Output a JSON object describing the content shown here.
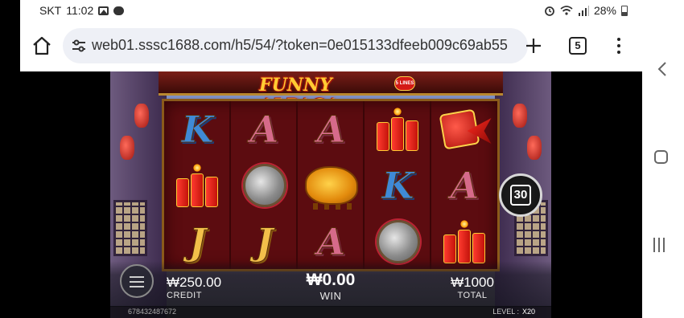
{
  "status_bar": {
    "carrier": "SKT",
    "time": "11:02",
    "battery": "28%"
  },
  "browser": {
    "url": "web01.sssc1688.com/h5/54/?token=0e015133dfeeb009c69ab55",
    "tab_count": "5"
  },
  "game": {
    "logo": "FUNNY ALPACA",
    "logo_badge": "5 LINES",
    "reels": [
      [
        "K-blue",
        "firecrackers",
        "J-gold"
      ],
      [
        "A-pink",
        "gong",
        "J-gold"
      ],
      [
        "A-pink",
        "golden-alpaca",
        "A-pink"
      ],
      [
        "firecrackers",
        "K-blue",
        "gong"
      ],
      [
        "big-firecracker",
        "A-pink",
        "firecrackers"
      ]
    ],
    "lines_button": "30",
    "credit_value": "₩250.00",
    "credit_label": "CREDIT",
    "win_value": "₩0.00",
    "win_label": "WIN",
    "total_value": "₩1000",
    "total_label": "TOTAL",
    "session_id": "678432487672",
    "level_label": "LEVEL :",
    "level_value": "X20"
  },
  "colors": {
    "reel_bg": "#5c0c10",
    "gold": "#f3c04a",
    "blue": "#3f8ad6",
    "pink": "#d66a8a"
  }
}
